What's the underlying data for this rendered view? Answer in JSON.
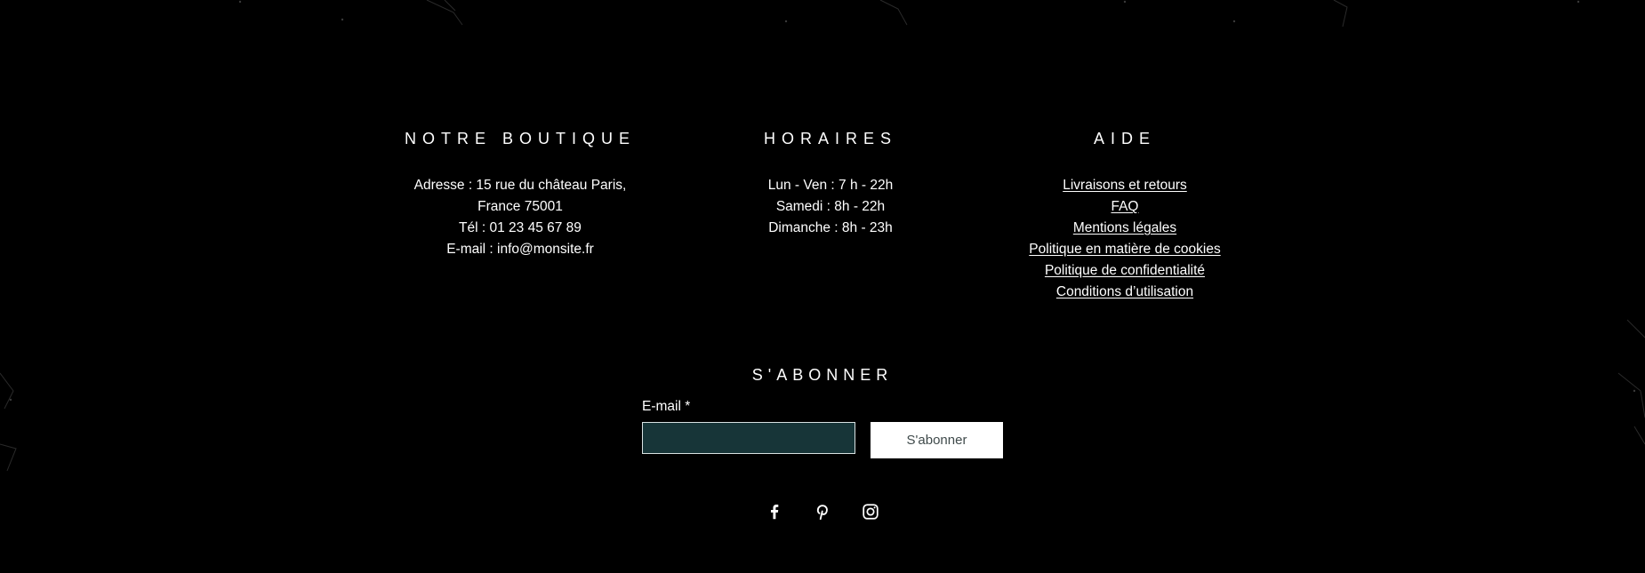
{
  "shop": {
    "title": "NOTRE BOUTIQUE",
    "lines": [
      "Adresse : 15 rue du château Paris,",
      "France 75001",
      "Tél : 01 23 45 67 89",
      "E-mail :  info@monsite.fr"
    ]
  },
  "hours": {
    "title": "HORAIRES",
    "lines": [
      "Lun - Ven : 7 h - 22h",
      "Samedi : 8h - 22h",
      "Dimanche : 8h - 23h"
    ]
  },
  "help": {
    "title": "AIDE",
    "links": [
      "Livraisons et retours",
      "FAQ",
      "Mentions légales",
      "Politique en matière de cookies",
      "Politique de confidentialité",
      "Conditions d’utilisation"
    ]
  },
  "subscribe": {
    "title": "S'ABONNER",
    "email_label": "E-mail *",
    "email_value": "",
    "button_label": "S'abonner"
  },
  "social": {
    "icons": [
      "facebook-icon",
      "pinterest-icon",
      "instagram-icon"
    ]
  },
  "colors": {
    "background": "#000000",
    "input_background": "#173538",
    "button_background": "#ffffff",
    "button_text": "#3f4a4b"
  }
}
